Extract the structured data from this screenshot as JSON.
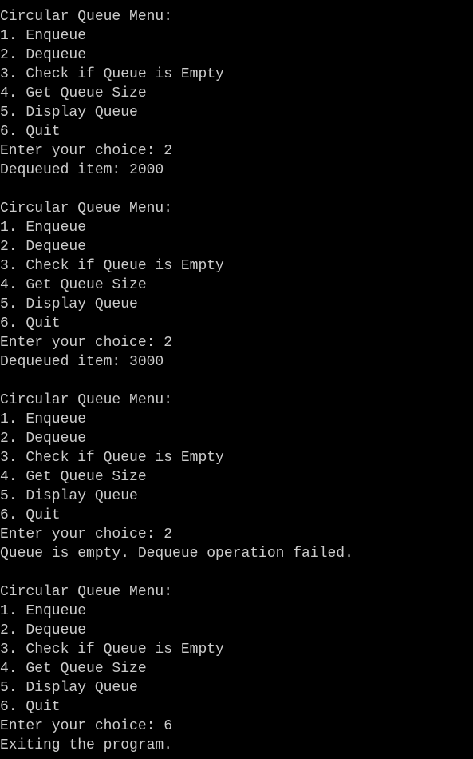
{
  "terminal": {
    "lines": [
      "Circular Queue Menu:",
      "1. Enqueue",
      "2. Dequeue",
      "3. Check if Queue is Empty",
      "4. Get Queue Size",
      "5. Display Queue",
      "6. Quit",
      "Enter your choice: 2",
      "Dequeued item: 2000",
      "",
      "Circular Queue Menu:",
      "1. Enqueue",
      "2. Dequeue",
      "3. Check if Queue is Empty",
      "4. Get Queue Size",
      "5. Display Queue",
      "6. Quit",
      "Enter your choice: 2",
      "Dequeued item: 3000",
      "",
      "Circular Queue Menu:",
      "1. Enqueue",
      "2. Dequeue",
      "3. Check if Queue is Empty",
      "4. Get Queue Size",
      "5. Display Queue",
      "6. Quit",
      "Enter your choice: 2",
      "Queue is empty. Dequeue operation failed.",
      "",
      "Circular Queue Menu:",
      "1. Enqueue",
      "2. Dequeue",
      "3. Check if Queue is Empty",
      "4. Get Queue Size",
      "5. Display Queue",
      "6. Quit",
      "Enter your choice: 6",
      "Exiting the program."
    ],
    "colors": {
      "background": "#000000",
      "foreground": "#cccccc"
    }
  }
}
